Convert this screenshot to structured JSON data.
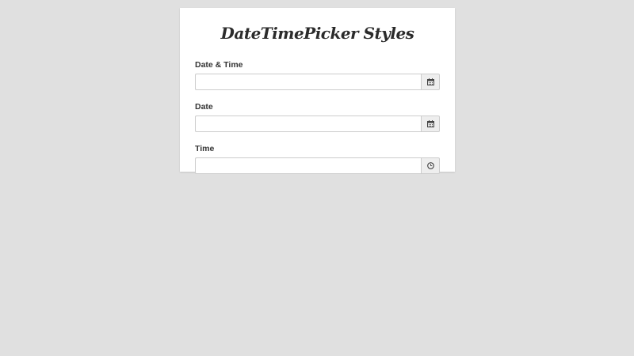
{
  "card": {
    "title": "DateTimePicker Styles"
  },
  "fields": [
    {
      "label": "Date & Time",
      "value": "",
      "placeholder": "",
      "icon": "calendar-icon"
    },
    {
      "label": "Date",
      "value": "",
      "placeholder": "",
      "icon": "calendar-icon"
    },
    {
      "label": "Time",
      "value": "",
      "placeholder": "",
      "icon": "clock-icon"
    }
  ],
  "colors": {
    "background": "#e0e0e0",
    "card": "#ffffff",
    "border": "#cccccc",
    "addon": "#eeeeee",
    "text": "#333333"
  }
}
